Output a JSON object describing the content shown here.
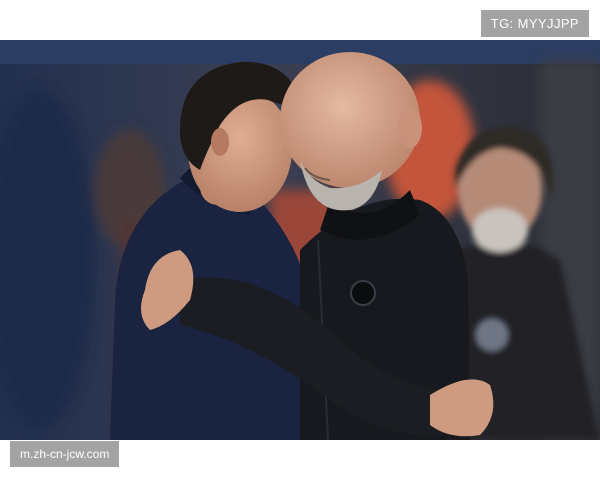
{
  "watermarks": {
    "top_right": "TG: MYYJJPP",
    "bottom_left": "m.zh-cn-jcw.com"
  },
  "photo": {
    "subject": "two football managers embracing on the touchline",
    "colors": {
      "background_dark": "#1d2433",
      "stand_blue": "#2c3d63",
      "left_coat": "#1a2440",
      "right_jacket": "#17191e",
      "skin": "#d6a48a",
      "bg_orange": "#c2553a"
    }
  }
}
